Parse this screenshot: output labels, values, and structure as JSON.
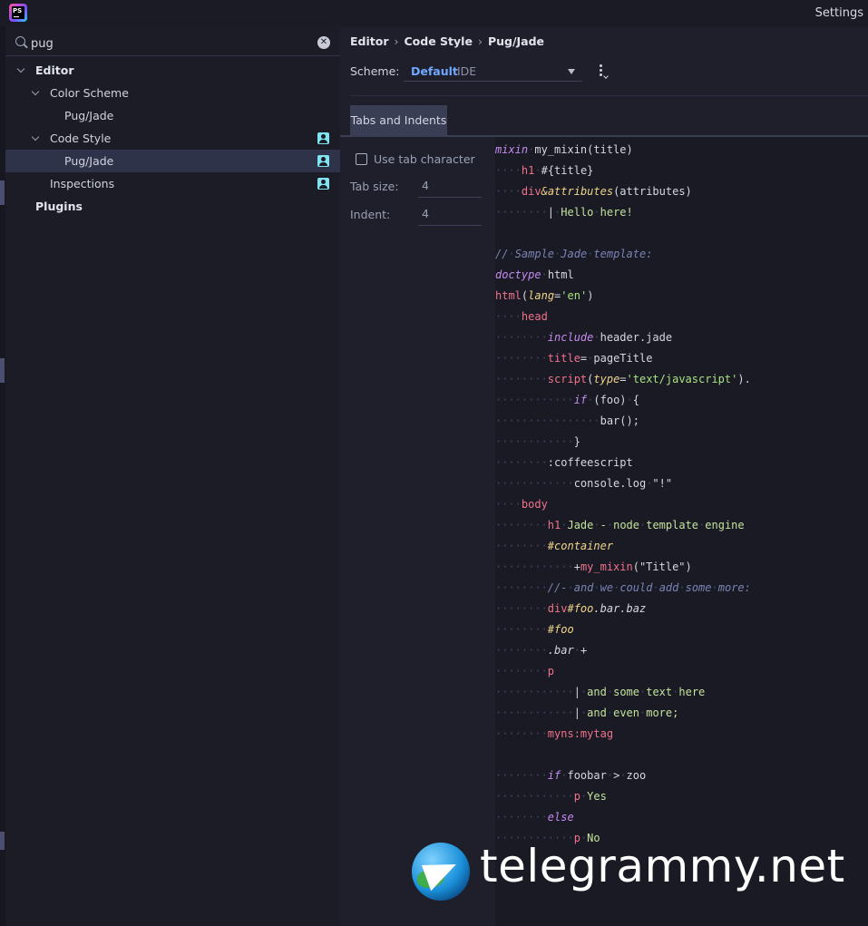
{
  "window": {
    "title": "Settings",
    "app_icon_text": "PS"
  },
  "search": {
    "value": "pug"
  },
  "tree": [
    {
      "label": "Editor"
    },
    {
      "label": "Color Scheme"
    },
    {
      "label": "Pug/Jade"
    },
    {
      "label": "Code Style"
    },
    {
      "label": "Pug/Jade"
    },
    {
      "label": "Inspections"
    },
    {
      "label": "Plugins"
    }
  ],
  "breadcrumb": {
    "items": [
      "Editor",
      "Code Style",
      "Pug/Jade"
    ],
    "separator": "›"
  },
  "scheme": {
    "label": "Scheme:",
    "name": "Default",
    "kind": "IDE"
  },
  "tabs": {
    "active": "Tabs and Indents"
  },
  "options": {
    "use_tab_label": "Use tab character",
    "use_tab_checked": false,
    "tab_size_label": "Tab size:",
    "tab_size_value": "4",
    "indent_label": "Indent:",
    "indent_value": "4"
  },
  "code_preview": [
    [
      [
        "kw",
        "mixin"
      ],
      [
        "ws",
        "·"
      ],
      [
        "plain",
        "my_mixin(title)"
      ]
    ],
    [
      [
        "ws",
        "····"
      ],
      [
        "tag",
        "h1"
      ],
      [
        "ws",
        "·"
      ],
      [
        "plain",
        "#{title}"
      ]
    ],
    [
      [
        "ws",
        "····"
      ],
      [
        "tag",
        "div"
      ],
      [
        "attr",
        "&attributes"
      ],
      [
        "plain",
        "(attributes)"
      ]
    ],
    [
      [
        "ws",
        "········"
      ],
      [
        "plain",
        "|"
      ],
      [
        "ws",
        "·"
      ],
      [
        "txt",
        "Hello"
      ],
      [
        "ws",
        "·"
      ],
      [
        "txt",
        "here!"
      ]
    ],
    [],
    [
      [
        "cm",
        "//"
      ],
      [
        "ws",
        "·"
      ],
      [
        "cm",
        "Sample"
      ],
      [
        "ws",
        "·"
      ],
      [
        "cm",
        "Jade"
      ],
      [
        "ws",
        "·"
      ],
      [
        "cm",
        "template:"
      ]
    ],
    [
      [
        "kw",
        "doctype"
      ],
      [
        "ws",
        "·"
      ],
      [
        "plain",
        "html"
      ]
    ],
    [
      [
        "tag",
        "html"
      ],
      [
        "plain",
        "("
      ],
      [
        "attr",
        "lang"
      ],
      [
        "plain",
        "="
      ],
      [
        "str",
        "'en'"
      ],
      [
        "plain",
        ")"
      ]
    ],
    [
      [
        "ws",
        "····"
      ],
      [
        "tag",
        "head"
      ]
    ],
    [
      [
        "ws",
        "········"
      ],
      [
        "kw",
        "include"
      ],
      [
        "ws",
        "·"
      ],
      [
        "plain",
        "header.jade"
      ]
    ],
    [
      [
        "ws",
        "········"
      ],
      [
        "tag",
        "title"
      ],
      [
        "plain",
        "="
      ],
      [
        "ws",
        "·"
      ],
      [
        "plain",
        "pageTitle"
      ]
    ],
    [
      [
        "ws",
        "········"
      ],
      [
        "tag",
        "script"
      ],
      [
        "plain",
        "("
      ],
      [
        "attr",
        "type"
      ],
      [
        "plain",
        "="
      ],
      [
        "str",
        "'text/javascript'"
      ],
      [
        "plain",
        ")."
      ]
    ],
    [
      [
        "ws",
        "············"
      ],
      [
        "kw",
        "if"
      ],
      [
        "ws",
        "·"
      ],
      [
        "plain",
        "(foo)"
      ],
      [
        "ws",
        "·"
      ],
      [
        "plain",
        "{"
      ]
    ],
    [
      [
        "ws",
        "················"
      ],
      [
        "plain",
        "bar();"
      ]
    ],
    [
      [
        "ws",
        "············"
      ],
      [
        "plain",
        "}"
      ]
    ],
    [
      [
        "ws",
        "········"
      ],
      [
        "plain",
        ":coffeescript"
      ]
    ],
    [
      [
        "ws",
        "············"
      ],
      [
        "plain",
        "console.log"
      ],
      [
        "ws",
        "·"
      ],
      [
        "plain",
        "\"!\""
      ]
    ],
    [
      [
        "ws",
        "····"
      ],
      [
        "tag",
        "body"
      ]
    ],
    [
      [
        "ws",
        "········"
      ],
      [
        "tag",
        "h1"
      ],
      [
        "ws",
        "·"
      ],
      [
        "txt",
        "Jade"
      ],
      [
        "ws",
        "·"
      ],
      [
        "txt",
        "-"
      ],
      [
        "ws",
        "·"
      ],
      [
        "txt",
        "node"
      ],
      [
        "ws",
        "·"
      ],
      [
        "txt",
        "template"
      ],
      [
        "ws",
        "·"
      ],
      [
        "txt",
        "engine"
      ]
    ],
    [
      [
        "ws",
        "········"
      ],
      [
        "id",
        "#container"
      ]
    ],
    [
      [
        "ws",
        "············"
      ],
      [
        "plain",
        "+"
      ],
      [
        "tag",
        "my_mixin"
      ],
      [
        "plain",
        "(\"Title\")"
      ]
    ],
    [
      [
        "ws",
        "········"
      ],
      [
        "cm",
        "//-"
      ],
      [
        "ws",
        "·"
      ],
      [
        "cm",
        "and"
      ],
      [
        "ws",
        "·"
      ],
      [
        "cm",
        "we"
      ],
      [
        "ws",
        "·"
      ],
      [
        "cm",
        "could"
      ],
      [
        "ws",
        "·"
      ],
      [
        "cm",
        "add"
      ],
      [
        "ws",
        "·"
      ],
      [
        "cm",
        "some"
      ],
      [
        "ws",
        "·"
      ],
      [
        "cm",
        "more:"
      ]
    ],
    [
      [
        "ws",
        "········"
      ],
      [
        "tag",
        "div"
      ],
      [
        "id",
        "#foo"
      ],
      [
        "cls",
        ".bar.baz"
      ]
    ],
    [
      [
        "ws",
        "········"
      ],
      [
        "id",
        "#foo"
      ]
    ],
    [
      [
        "ws",
        "········"
      ],
      [
        "cls",
        ".bar"
      ],
      [
        "ws",
        "·"
      ],
      [
        "plain",
        "+"
      ]
    ],
    [
      [
        "ws",
        "········"
      ],
      [
        "tag",
        "p"
      ]
    ],
    [
      [
        "ws",
        "············"
      ],
      [
        "plain",
        "|"
      ],
      [
        "ws",
        "·"
      ],
      [
        "txt",
        "and"
      ],
      [
        "ws",
        "·"
      ],
      [
        "txt",
        "some"
      ],
      [
        "ws",
        "·"
      ],
      [
        "txt",
        "text"
      ],
      [
        "ws",
        "·"
      ],
      [
        "txt",
        "here"
      ]
    ],
    [
      [
        "ws",
        "············"
      ],
      [
        "plain",
        "|"
      ],
      [
        "ws",
        "·"
      ],
      [
        "txt",
        "and"
      ],
      [
        "ws",
        "·"
      ],
      [
        "txt",
        "even"
      ],
      [
        "ws",
        "·"
      ],
      [
        "txt",
        "more;"
      ]
    ],
    [
      [
        "ws",
        "········"
      ],
      [
        "tag",
        "myns:mytag"
      ]
    ],
    [],
    [
      [
        "ws",
        "········"
      ],
      [
        "kw",
        "if"
      ],
      [
        "ws",
        "·"
      ],
      [
        "plain",
        "foobar"
      ],
      [
        "ws",
        "·"
      ],
      [
        "plain",
        ">"
      ],
      [
        "ws",
        "·"
      ],
      [
        "plain",
        "zoo"
      ]
    ],
    [
      [
        "ws",
        "············"
      ],
      [
        "tag",
        "p"
      ],
      [
        "ws",
        "·"
      ],
      [
        "txt",
        "Yes"
      ]
    ],
    [
      [
        "ws",
        "········"
      ],
      [
        "kw",
        "else"
      ]
    ],
    [
      [
        "ws",
        "············"
      ],
      [
        "tag",
        "p"
      ],
      [
        "ws",
        "·"
      ],
      [
        "txt",
        "No"
      ]
    ]
  ],
  "watermark": {
    "text": "telegrammy.net",
    "logo_icon": "telegram-globe-icon"
  },
  "colors": {
    "accent": "#6ea8ff",
    "selection": "#2f334a",
    "profile_icon": "#7fe3f0",
    "keyword": "#c58cf0",
    "tag": "#f0738a",
    "string": "#a8e27f",
    "comment": "#7b83b3"
  }
}
